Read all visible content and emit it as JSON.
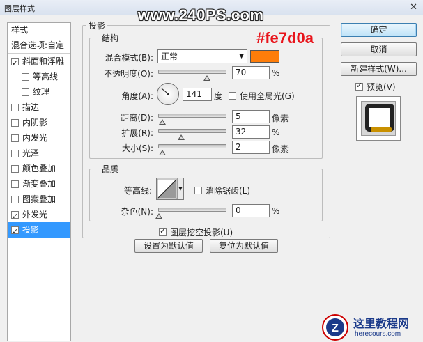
{
  "window": {
    "title": "图层样式",
    "close_glyph": "✕"
  },
  "watermark": "www.240PS.com",
  "color_annotation": "#fe7d0a",
  "sidebar": {
    "header": "样式",
    "blend_options": "混合选项:自定",
    "items": [
      {
        "label": "斜面和浮雕",
        "checked": true,
        "indent": false
      },
      {
        "label": "等高线",
        "checked": false,
        "indent": true
      },
      {
        "label": "纹理",
        "checked": false,
        "indent": true
      },
      {
        "label": "描边",
        "checked": false,
        "indent": false
      },
      {
        "label": "内阴影",
        "checked": false,
        "indent": false
      },
      {
        "label": "内发光",
        "checked": false,
        "indent": false
      },
      {
        "label": "光泽",
        "checked": false,
        "indent": false
      },
      {
        "label": "颜色叠加",
        "checked": false,
        "indent": false
      },
      {
        "label": "渐变叠加",
        "checked": false,
        "indent": false
      },
      {
        "label": "图案叠加",
        "checked": false,
        "indent": false
      },
      {
        "label": "外发光",
        "checked": true,
        "indent": false
      },
      {
        "label": "投影",
        "checked": true,
        "indent": false,
        "selected": true
      }
    ]
  },
  "drop_shadow": {
    "title": "投影",
    "structure": {
      "title": "结构",
      "blend_mode_label": "混合模式(B):",
      "blend_mode_value": "正常",
      "color": "#fe7d0a",
      "opacity_label": "不透明度(O):",
      "opacity_value": "70",
      "opacity_unit": "%",
      "angle_label": "角度(A):",
      "angle_value": "141",
      "angle_unit": "度",
      "global_light_label": "使用全局光(G)",
      "global_light_checked": false,
      "distance_label": "距离(D):",
      "distance_value": "5",
      "distance_unit": "像素",
      "spread_label": "扩展(R):",
      "spread_value": "32",
      "spread_unit": "%",
      "size_label": "大小(S):",
      "size_value": "2",
      "size_unit": "像素"
    },
    "quality": {
      "title": "品质",
      "contour_label": "等高线:",
      "anti_alias_label": "消除锯齿(L)",
      "anti_alias_checked": false,
      "noise_label": "杂色(N):",
      "noise_value": "0",
      "noise_unit": "%"
    },
    "knockout_label": "图层挖空投影(U)",
    "knockout_checked": true,
    "make_default_label": "设置为默认值",
    "reset_default_label": "复位为默认值"
  },
  "buttons": {
    "ok": "确定",
    "cancel": "取消",
    "new_style": "新建样式(W)...",
    "preview_label": "预览(V)",
    "preview_checked": true
  },
  "logo": {
    "name": "这里教程网",
    "url": "herecours.com"
  }
}
